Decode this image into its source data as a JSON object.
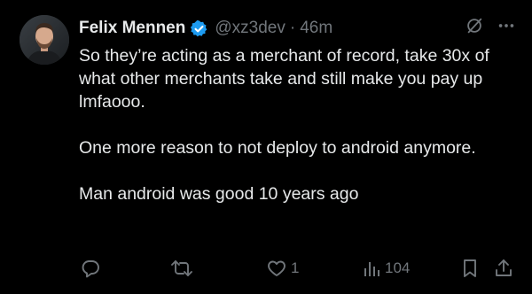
{
  "author": {
    "name": "Felix Mennen",
    "handle": "@xz3dev",
    "separator": "·",
    "time": "46m",
    "verified": true
  },
  "body": {
    "paragraphs": [
      "So they’re acting as a merchant of record, take 30x of what other merchants take and still make you pay up lmfaooo.",
      "One more reason to not deploy to android anymore.",
      "Man android was good 10 years ago"
    ]
  },
  "actions": {
    "reply_count": "",
    "retweet_count": "",
    "like_count": "1",
    "views_count": "104"
  },
  "icons": {
    "grok": "slash-circle-icon",
    "more": "more-icon",
    "reply": "reply-icon",
    "retweet": "retweet-icon",
    "like": "heart-icon",
    "views": "views-icon",
    "bookmark": "bookmark-icon",
    "share": "share-icon"
  },
  "colors": {
    "background": "#000000",
    "text": "#e7e9ea",
    "muted": "#71767b",
    "verified": "#1d9bf0"
  }
}
